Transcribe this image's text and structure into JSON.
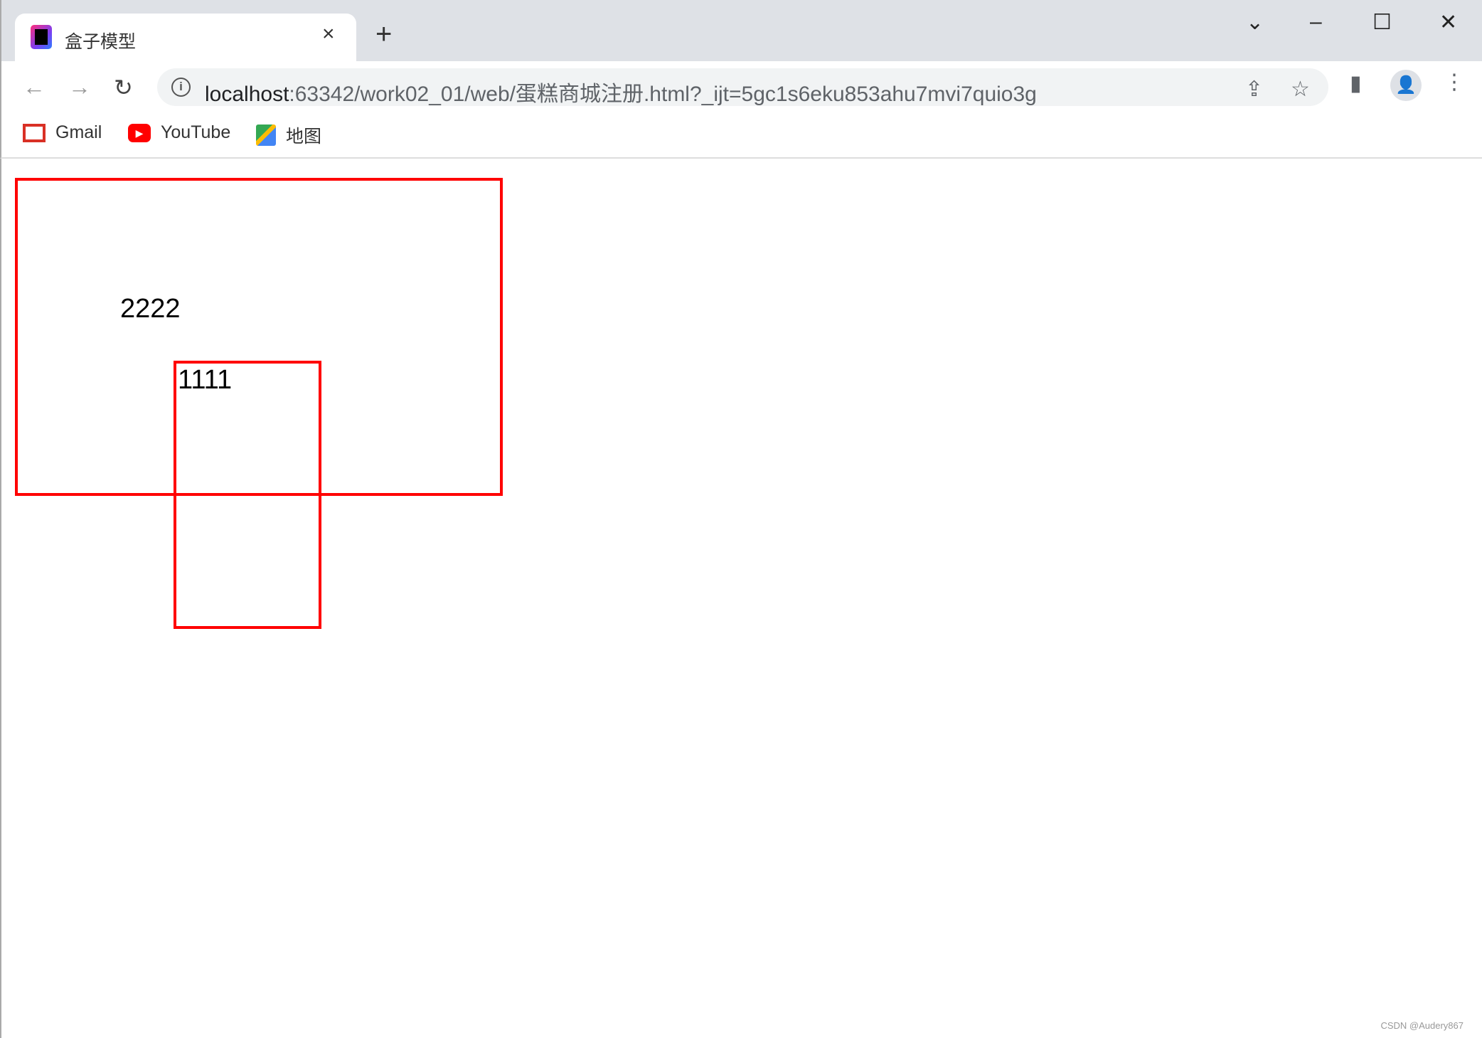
{
  "browser": {
    "tab": {
      "title": "盒子模型",
      "favicon": "intellij-icon",
      "close": "×"
    },
    "new_tab": "+",
    "window_controls": {
      "tab_search": "⌄",
      "minimize": "–",
      "maximize": "☐",
      "close": "✕"
    },
    "nav": {
      "back": "←",
      "forward": "→",
      "reload": "↻"
    },
    "address": {
      "host": "localhost",
      "rest": ":63342/work02_01/web/蛋糕商城注册.html?_ijt=5gc1s6eku853ahu7mvi7quio3g",
      "info": "i"
    },
    "right_icons": {
      "share": "⇪",
      "star": "☆",
      "side_panel": "▮",
      "profile": "👤",
      "menu": "⋮"
    },
    "bookmarks": [
      {
        "label": "Gmail",
        "icon": "gmail-icon"
      },
      {
        "label": "YouTube",
        "icon": "youtube-icon"
      },
      {
        "label": "地图",
        "icon": "maps-icon"
      }
    ]
  },
  "page": {
    "outer_box_text": "2222",
    "inner_box_text": "1111",
    "border_color": "#ff0000"
  },
  "watermark": "CSDN @Audery867"
}
